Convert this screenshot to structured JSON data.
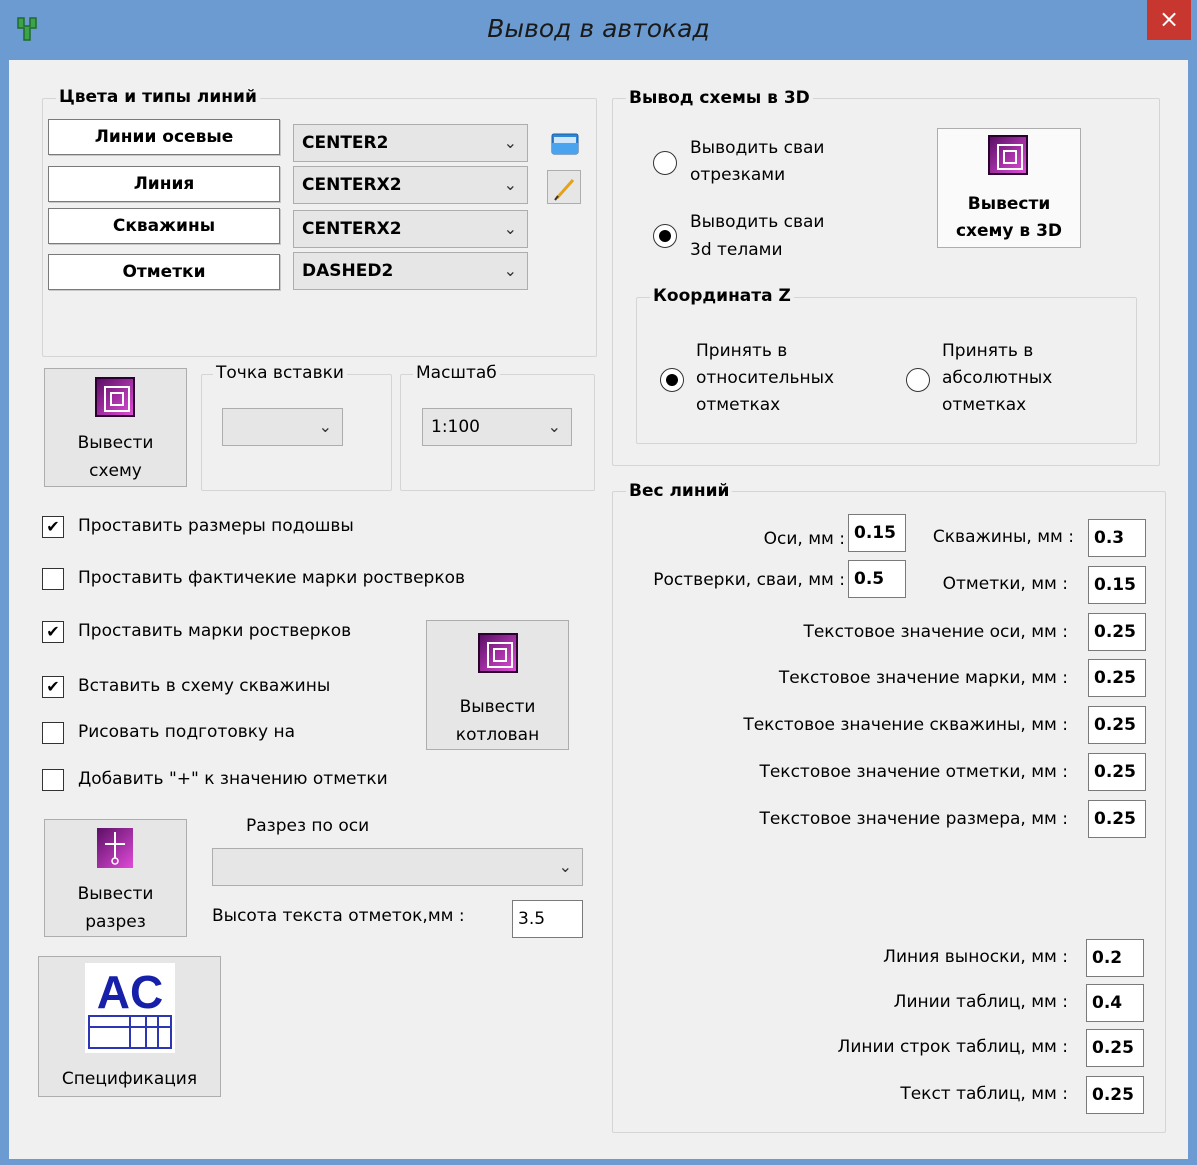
{
  "window": {
    "title": "Вывод в автокад",
    "close": "×"
  },
  "line_types": {
    "title": "Цвета и типы линий",
    "rows": [
      {
        "label": "Линии осевые",
        "value": "CENTER2"
      },
      {
        "label": "Линия",
        "value": "CENTERX2"
      },
      {
        "label": "Скважины",
        "value": "CENTERX2"
      },
      {
        "label": "Отметки",
        "value": "DASHED2"
      }
    ],
    "open_icon": "folder-open-icon",
    "edit_icon": "pencil-icon"
  },
  "scheme": {
    "button_line1": "Вывести",
    "button_line2": "схему",
    "insert_point_title": "Точка вставки",
    "insert_point_value": "",
    "scale_title": "Масштаб",
    "scale_value": "1:100"
  },
  "options": {
    "dims": {
      "label": "Проставить размеры подошвы",
      "checked": true
    },
    "actual_marks": {
      "label": "Проставить фактичекие марки ростверков",
      "checked": false
    },
    "marks": {
      "label": "Проставить марки ростверков",
      "checked": true
    },
    "wells": {
      "label": "Вставить в схему скважины",
      "checked": true
    },
    "prep": {
      "label": "Рисовать подготовку на",
      "checked": false
    },
    "plus": {
      "label": "Добавить \"+\" к значению отметки",
      "checked": false
    }
  },
  "pit": {
    "line1": "Вывести",
    "line2": "котлован"
  },
  "section": {
    "axis_title": "Разрез по оси",
    "axis_value": "",
    "button_line1": "Вывести",
    "button_line2": "разрез",
    "text_height_label": "Высота текста отметок,мм :",
    "text_height_value": "3.5"
  },
  "spec": {
    "logo_text": "AC",
    "label": "Спецификация"
  },
  "scheme3d": {
    "title": "Вывод схемы в 3D",
    "radio_segments_line1": "Выводить сваи",
    "radio_segments_line2": "отрезками",
    "radio_solids_line1": "Выводить сваи",
    "radio_solids_line2": "3d телами",
    "selected": "solids",
    "button_line1": "Вывести",
    "button_line2": "схему в 3D",
    "coord_title": "Координата Z",
    "rel_line1": "Принять в",
    "rel_line2": "относительных",
    "rel_line3": "отметках",
    "abs_line1": "Принять в",
    "abs_line2": "абсолютных",
    "abs_line3": "отметках",
    "coord_selected": "relative"
  },
  "weights": {
    "title": "Вес линий",
    "axes_label": "Оси, мм :",
    "axes_value": "0.15",
    "wells_label": "Скважины, мм :",
    "wells_value": "0.3",
    "grillage_label": "Ростверки, сваи, мм :",
    "grillage_value": "0.5",
    "marks_label": "Отметки, мм :",
    "marks_value": "0.15",
    "rows": [
      {
        "label": "Текстовое значение оси, мм :",
        "value": "0.25"
      },
      {
        "label": "Текстовое значение марки, мм :",
        "value": "0.25"
      },
      {
        "label": "Текстовое значение скважины, мм :",
        "value": "0.25"
      },
      {
        "label": "Текстовое значение отметки, мм :",
        "value": "0.25"
      },
      {
        "label": "Текстовое значение размера, мм :",
        "value": "0.25"
      }
    ],
    "leader_label": "Линия выноски, мм :",
    "leader_value": "0.2",
    "table_lines_label": "Линии таблиц, мм :",
    "table_lines_value": "0.4",
    "table_rows_label": "Линии строк таблиц, мм :",
    "table_rows_value": "0.25",
    "table_text_label": "Текст таблиц, мм :",
    "table_text_value": "0.25"
  },
  "colors": {
    "titlebar": "#6b9bd1",
    "close": "#c7372f",
    "icon": "#c23ab8"
  }
}
